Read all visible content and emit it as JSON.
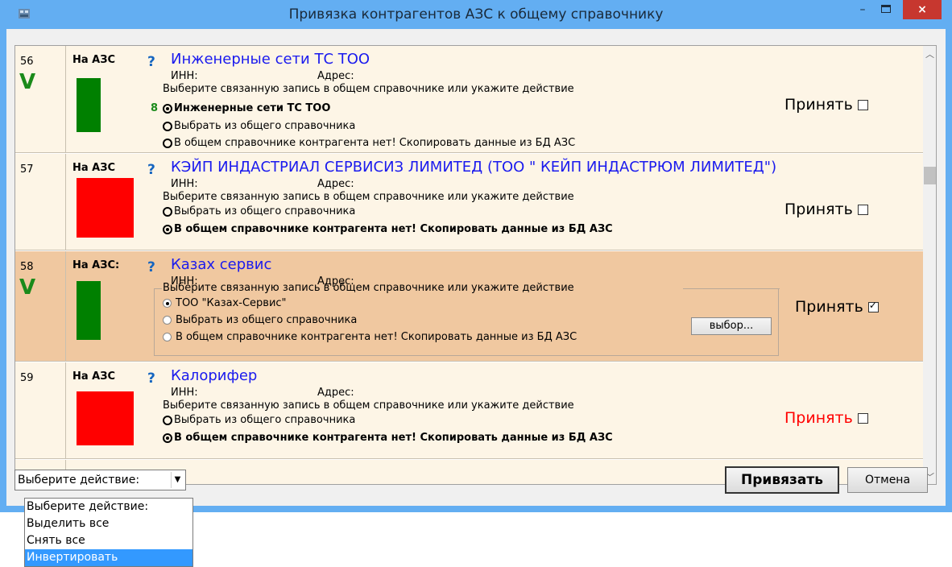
{
  "window": {
    "title": "Привязка контрагентов АЗС к общему справочнику",
    "close_label": "×"
  },
  "rows": [
    {
      "num": "56",
      "check": "V",
      "on_azs": "На АЗС",
      "q": "?",
      "status": "green",
      "name": "Инженерные сети ТС ТОО",
      "inn": "ИНН:",
      "addr": "Адрес:",
      "prompt": "Выберите связанную запись в общем справочнике или укажите действие",
      "badge": "8",
      "options": [
        {
          "label": "Инженерные сети ТС ТОО",
          "selected": true,
          "bold": true
        },
        {
          "label": "Выбрать из общего справочника",
          "selected": false,
          "bold": false
        },
        {
          "label": "В общем справочнике контрагента нет! Скопировать данные из БД АЗС",
          "selected": false,
          "bold": false
        }
      ],
      "accept": "Принять",
      "accept_checked": false
    },
    {
      "num": "57",
      "check": "",
      "on_azs": "На АЗС",
      "q": "?",
      "status": "red",
      "name": "КЭЙП ИНДАСТРИАЛ СЕРВИСИЗ ЛИМИТЕД  (ТОО \" КЕЙП ИНДАСТРЮМ ЛИМИТЕД\")",
      "inn": "ИНН:",
      "addr": "Адрес:",
      "prompt": "Выберите связанную запись в общем справочнике или укажите действие",
      "options": [
        {
          "label": "Выбрать из общего справочника",
          "selected": false,
          "bold": false
        },
        {
          "label": "В общем справочнике контрагента нет! Скопировать данные из БД АЗС",
          "selected": true,
          "bold": true
        }
      ],
      "accept": "Принять",
      "accept_checked": false
    },
    {
      "num": "58",
      "check": "V",
      "on_azs": "На АЗС:",
      "q": "?",
      "status": "green",
      "name": "Казах сервис",
      "inn": "ИНН:",
      "addr": "Адрес:",
      "prompt": "Выберите связанную запись в общем справочнике или укажите действие",
      "options": [
        {
          "label": "ТОО \"Казах-Сервис\"",
          "selected": true
        },
        {
          "label": "Выбрать из общего справочника",
          "selected": false
        },
        {
          "label": "В общем справочнике контрагента нет! Скопировать данные из БД АЗС",
          "selected": false
        }
      ],
      "pick_button": "выбор...",
      "accept": "Принять",
      "accept_checked": true
    },
    {
      "num": "59",
      "check": "",
      "on_azs": "На АЗС",
      "q": "?",
      "status": "red",
      "name": "Калорифер",
      "inn": "ИНН:",
      "addr": "Адрес:",
      "prompt": "Выберите связанную запись в общем справочнике или укажите действие",
      "options": [
        {
          "label": "Выбрать из общего справочника",
          "selected": false,
          "bold": false
        },
        {
          "label": "В общем справочнике контрагента нет! Скопировать данные из БД АЗС",
          "selected": true,
          "bold": true
        }
      ],
      "accept": "Принять",
      "accept_color": "#ff0000",
      "accept_checked": false
    }
  ],
  "footer": {
    "action_combo": "Выберите действие:",
    "bind_button": "Привязать",
    "cancel_button": "Отмена"
  },
  "dropdown": {
    "items": [
      "Выберите действие:",
      "Выделить все",
      "Снять все",
      "Инвертировать"
    ],
    "highlighted_index": 3
  },
  "colors": {
    "titlebar": "#63aef2",
    "row_bg": "#fdf5e6",
    "row_selected_bg": "#f0c8a0",
    "status_green": "#008000",
    "status_red": "#ff0000",
    "name_blue": "#1a1aee",
    "close_red": "#c7372f",
    "highlight": "#3399ff"
  }
}
